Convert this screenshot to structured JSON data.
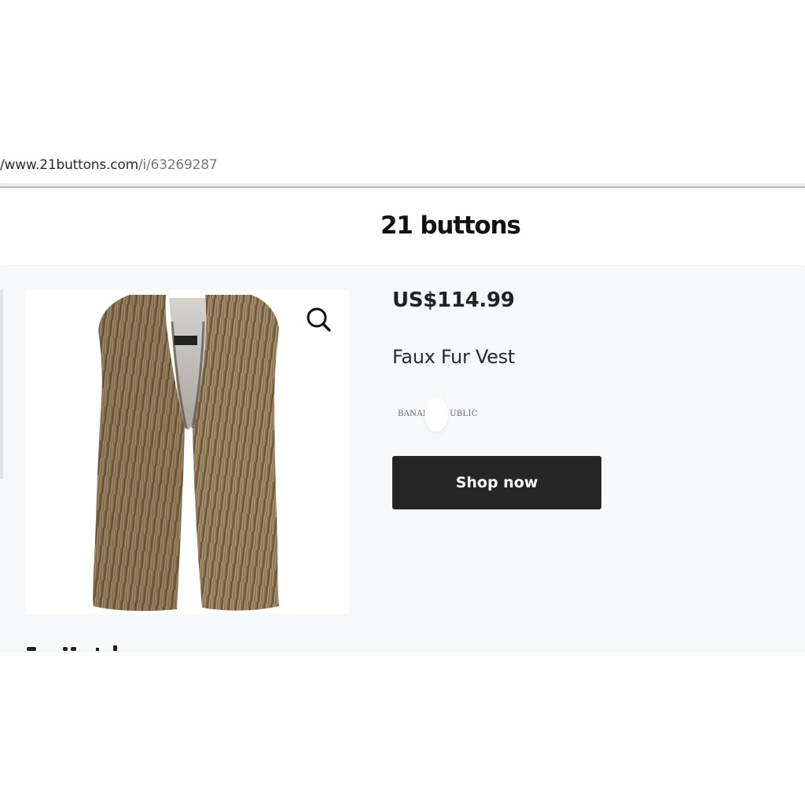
{
  "browser": {
    "url_main": "/www.21buttons.com",
    "url_path": "/i/63269287"
  },
  "header": {
    "logo_text": "21 buttons"
  },
  "product": {
    "price": "US$114.99",
    "name": "Faux Fur Vest",
    "brand": {
      "left_text": "BANAN",
      "right_text": "UBLIC"
    },
    "shop_button_label": "Shop now",
    "image_icon": "zoom-icon"
  },
  "colors": {
    "button_bg": "#262626",
    "content_bg": "#f7f8fa",
    "fur_primary": "#8a7459"
  }
}
